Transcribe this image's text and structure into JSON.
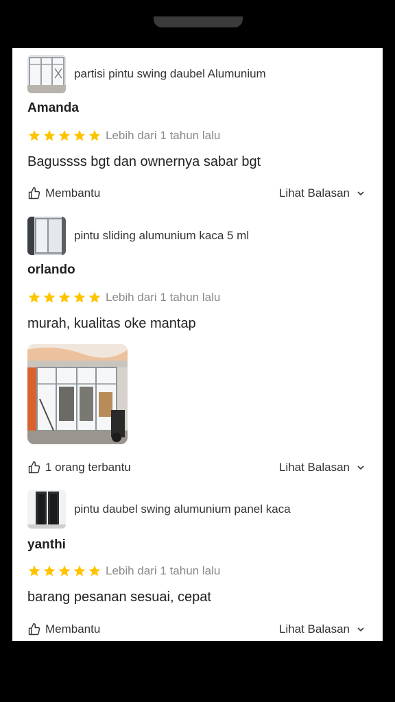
{
  "reviews": [
    {
      "product": "partisi pintu swing daubel Alumunium",
      "reviewer": "Amanda",
      "rating": 5,
      "time": "Lebih dari 1 tahun lalu",
      "comment": "Bagussss bgt dan ownernya sabar bgt",
      "helpful": "Membantu",
      "replies": "Lihat Balasan"
    },
    {
      "product": "pintu sliding alumunium kaca 5 ml",
      "reviewer": "orlando",
      "rating": 5,
      "time": "Lebih dari 1 tahun lalu",
      "comment": "murah, kualitas oke mantap",
      "helpful": "1 orang terbantu",
      "replies": "Lihat Balasan"
    },
    {
      "product": "pintu daubel swing alumunium panel kaca",
      "reviewer": "yanthi",
      "rating": 5,
      "time": "Lebih dari 1 tahun lalu",
      "comment": "barang pesanan sesuai, cepat",
      "helpful": "Membantu",
      "replies": "Lihat Balasan"
    }
  ],
  "colors": {
    "star": "#FFC400",
    "background": "#000000",
    "panel": "#FFFFFF"
  },
  "icons": {
    "star": "star-icon",
    "helpful": "thumbs-up-icon",
    "replies": "chevron-down-icon"
  }
}
